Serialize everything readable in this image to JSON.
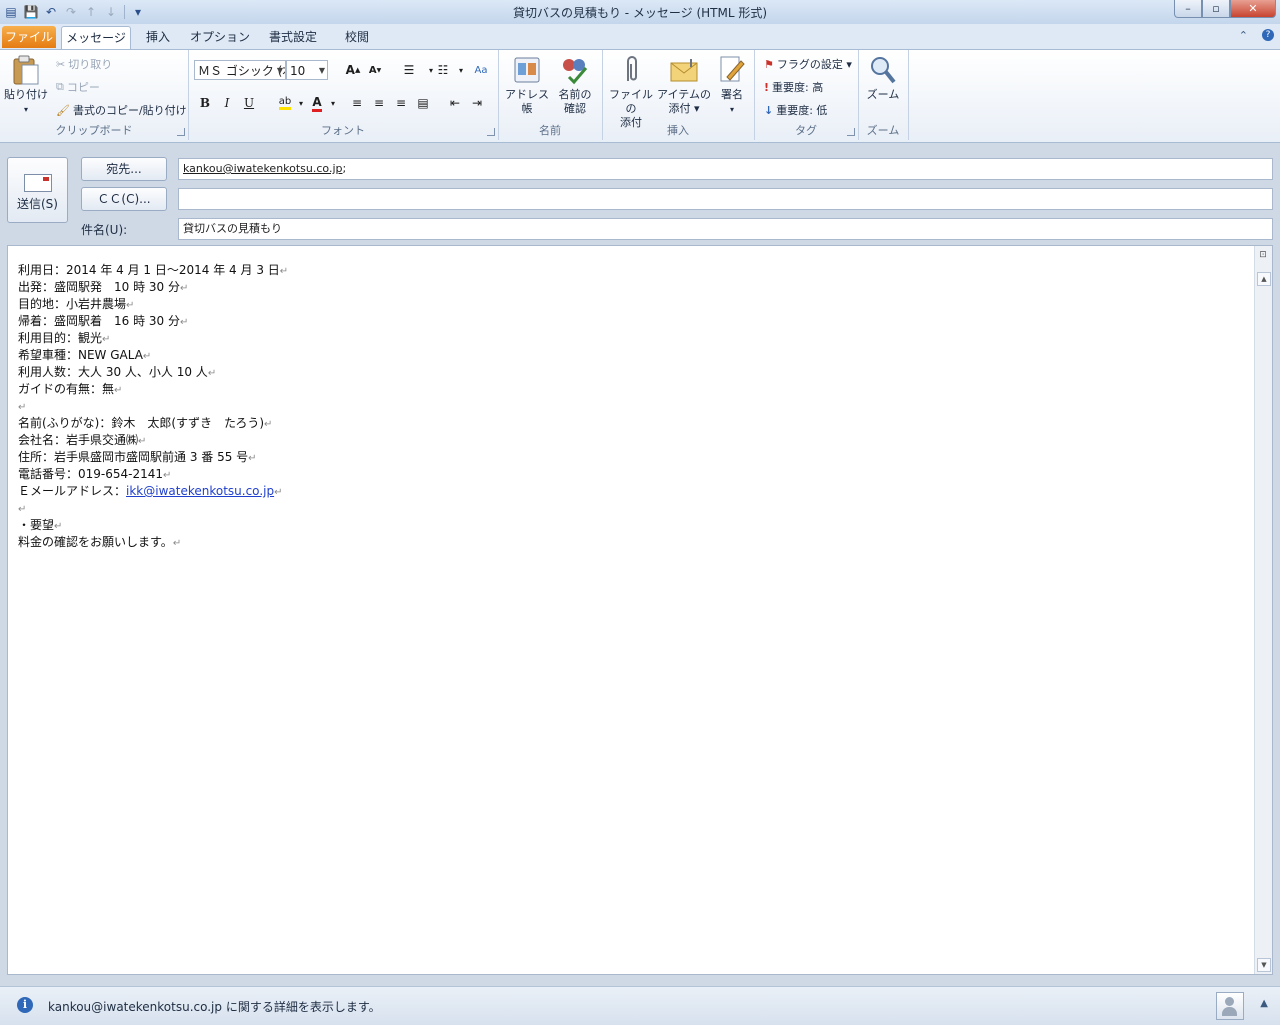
{
  "window": {
    "title": "貸切バスの見積もり - メッセージ (HTML 形式)",
    "min": "–",
    "max": "▫",
    "close": "✕"
  },
  "qat": {
    "save": "💾",
    "undo": "↶",
    "redo": "↷",
    "up": "↑",
    "down": "↓",
    "more": "▾"
  },
  "tabs": [
    "ファイル",
    "メッセージ",
    "挿入",
    "オプション",
    "書式設定",
    "校閲"
  ],
  "ribbon": {
    "clipboard": {
      "label": "クリップボード",
      "paste": "貼り付け",
      "cut": "切り取り",
      "copy": "コピー",
      "format_painter": "書式のコピー/貼り付け"
    },
    "font": {
      "label": "フォント",
      "font_name": "ＭＳ ゴシック (本",
      "font_size": "10"
    },
    "names": {
      "label": "名前",
      "address_book": "アドレス帳",
      "check_names_1": "名前の",
      "check_names_2": "確認"
    },
    "include": {
      "label": "挿入",
      "attach_file_1": "ファイルの",
      "attach_file_2": "添付",
      "attach_item_1": "アイテムの",
      "attach_item_2": "添付 ▾",
      "signature": "署名"
    },
    "tags": {
      "label": "タグ",
      "follow_up": "フラグの設定 ▾",
      "high": "重要度: 高",
      "low": "重要度: 低"
    },
    "zoom": {
      "label": "ズーム",
      "zoom": "ズーム"
    }
  },
  "compose": {
    "send": "送信(S)",
    "to_button": "宛先...",
    "cc_button": "ＣＣ(C)...",
    "subject_label": "件名(U):",
    "to_value": "kankou@iwatekenkotsu.co.jp",
    "to_suffix": ";",
    "cc_value": "",
    "subject_value": "貸切バスの見積もり"
  },
  "body": {
    "lines": [
      "利用日：2014 年 4 月 1 日～2014 年 4 月 3 日",
      "出発：盛岡駅発　10 時 30 分",
      "目的地：小岩井農場",
      "帰着：盛岡駅着　16 時 30 分",
      "利用目的：観光",
      "希望車種：NEW GALA",
      "利用人数：大人 30 人、小人 10 人",
      "ガイドの有無：無",
      "",
      "名前(ふりがな)：鈴木　太郎(すずき　たろう)",
      "会社名：岩手県交通㈱",
      "住所：岩手県盛岡市盛岡駅前通 3 番 55 号",
      "電話番号：019-654-2141",
      "Ｅメールアドレス：",
      "",
      "・要望",
      "料金の確認をお願いします。"
    ],
    "email_link": "ikk@iwatekenkotsu.co.jp",
    "para_mark": "↵"
  },
  "status": {
    "message": "kankou@iwatekenkotsu.co.jp に関する詳細を表示します。",
    "info_glyph": "i"
  }
}
